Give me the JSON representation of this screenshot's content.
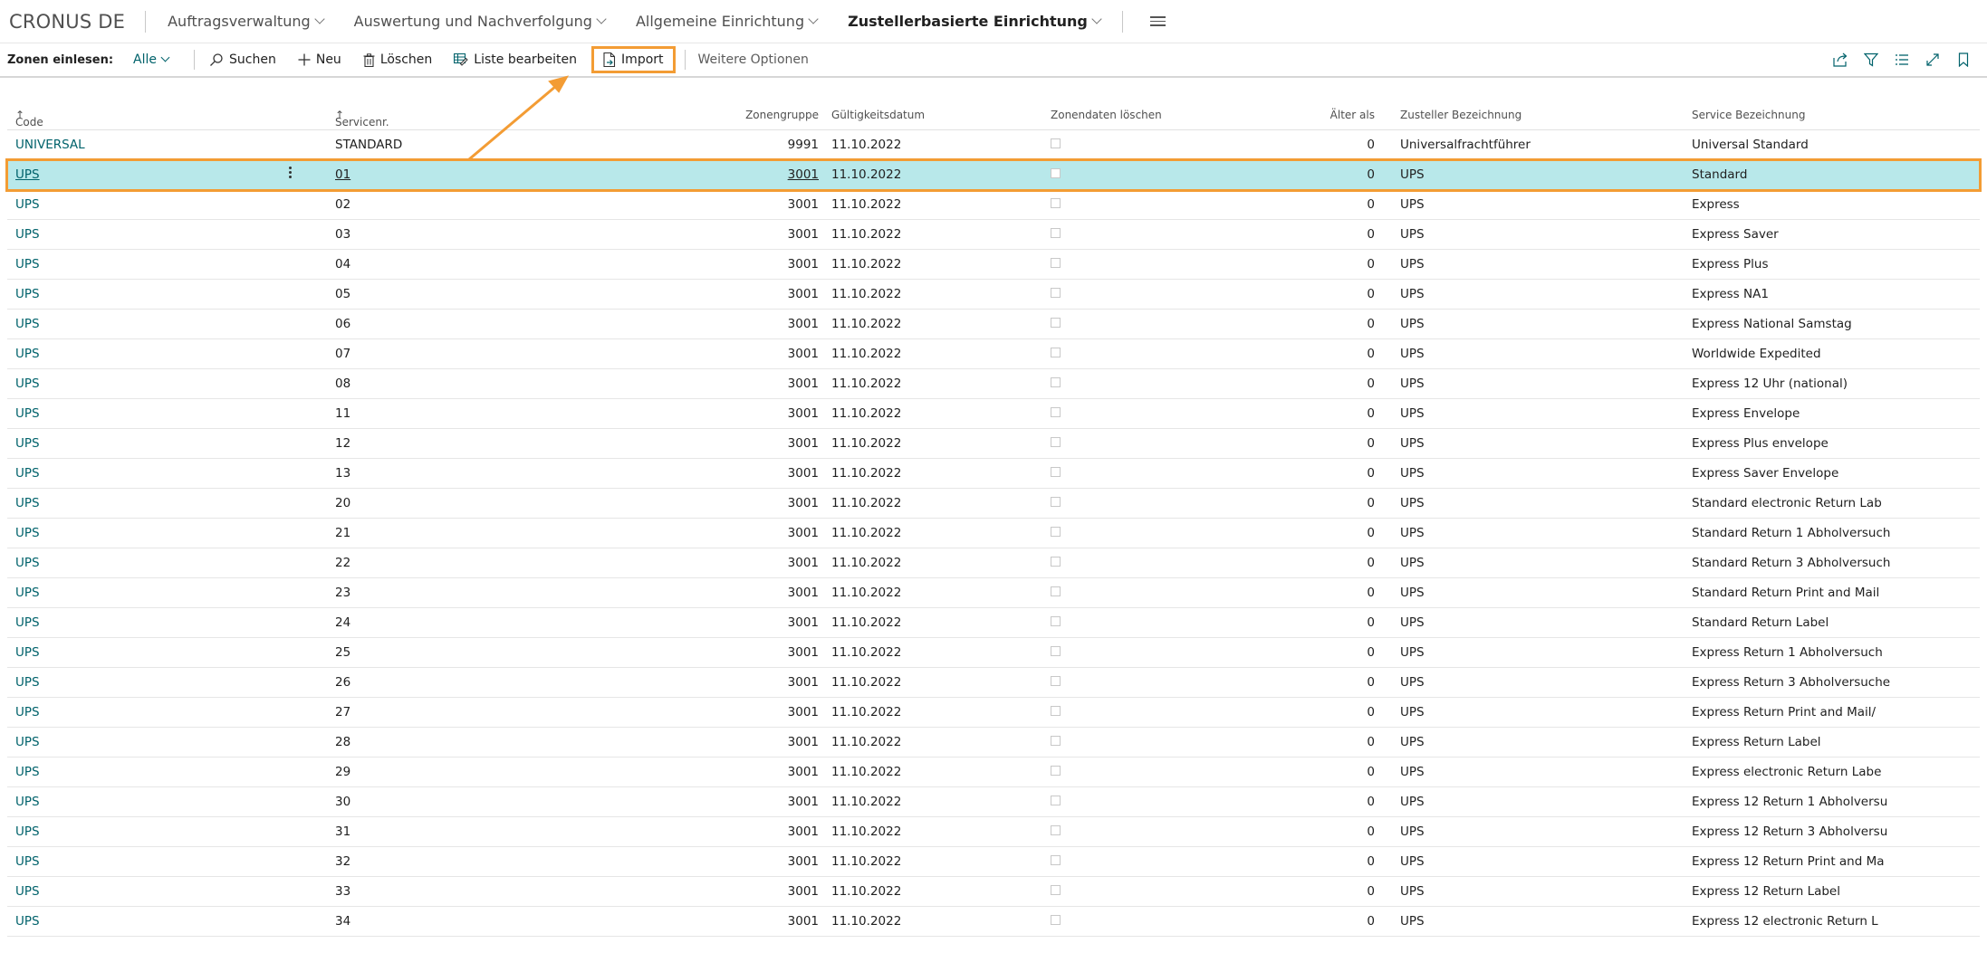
{
  "topnav": {
    "company": "CRONUS DE",
    "items": [
      {
        "label": "Auftragsverwaltung"
      },
      {
        "label": "Auswertung und Nachverfolgung"
      },
      {
        "label": "Allgemeine Einrichtung"
      },
      {
        "label": "Zustellerbasierte Einrichtung"
      }
    ]
  },
  "actionbar": {
    "label": "Zonen einlesen:",
    "filter": "Alle",
    "search": "Suchen",
    "new": "Neu",
    "delete": "Löschen",
    "edit_list": "Liste bearbeiten",
    "import": "Import",
    "more_options": "Weitere Optionen"
  },
  "columns": {
    "code": "Code",
    "service_no": "Servicenr.",
    "zone_group": "Zonengruppe",
    "valid_date": "Gültigkeitsdatum",
    "delete_zone": "Zonendaten löschen",
    "older_than": "Älter als",
    "carrier_name": "Zusteller Bezeichnung",
    "service_name": "Service Bezeichnung"
  },
  "rows": [
    {
      "code": "UNIVERSAL",
      "svc": "STANDARD",
      "zone": "9991",
      "date": "11.10.2022",
      "age": "0",
      "carrier": "Universalfrachtführer",
      "name": "Universal Standard"
    },
    {
      "code": "UPS",
      "svc": "01",
      "zone": "3001",
      "date": "11.10.2022",
      "age": "0",
      "carrier": "UPS",
      "name": "Standard"
    },
    {
      "code": "UPS",
      "svc": "02",
      "zone": "3001",
      "date": "11.10.2022",
      "age": "0",
      "carrier": "UPS",
      "name": "Express"
    },
    {
      "code": "UPS",
      "svc": "03",
      "zone": "3001",
      "date": "11.10.2022",
      "age": "0",
      "carrier": "UPS",
      "name": "Express Saver"
    },
    {
      "code": "UPS",
      "svc": "04",
      "zone": "3001",
      "date": "11.10.2022",
      "age": "0",
      "carrier": "UPS",
      "name": "Express Plus"
    },
    {
      "code": "UPS",
      "svc": "05",
      "zone": "3001",
      "date": "11.10.2022",
      "age": "0",
      "carrier": "UPS",
      "name": "Express NA1"
    },
    {
      "code": "UPS",
      "svc": "06",
      "zone": "3001",
      "date": "11.10.2022",
      "age": "0",
      "carrier": "UPS",
      "name": "Express National Samstag"
    },
    {
      "code": "UPS",
      "svc": "07",
      "zone": "3001",
      "date": "11.10.2022",
      "age": "0",
      "carrier": "UPS",
      "name": "Worldwide Expedited"
    },
    {
      "code": "UPS",
      "svc": "08",
      "zone": "3001",
      "date": "11.10.2022",
      "age": "0",
      "carrier": "UPS",
      "name": "Express 12 Uhr (national)"
    },
    {
      "code": "UPS",
      "svc": "11",
      "zone": "3001",
      "date": "11.10.2022",
      "age": "0",
      "carrier": "UPS",
      "name": "Express Envelope"
    },
    {
      "code": "UPS",
      "svc": "12",
      "zone": "3001",
      "date": "11.10.2022",
      "age": "0",
      "carrier": "UPS",
      "name": "Express Plus envelope"
    },
    {
      "code": "UPS",
      "svc": "13",
      "zone": "3001",
      "date": "11.10.2022",
      "age": "0",
      "carrier": "UPS",
      "name": "Express Saver Envelope"
    },
    {
      "code": "UPS",
      "svc": "20",
      "zone": "3001",
      "date": "11.10.2022",
      "age": "0",
      "carrier": "UPS",
      "name": "Standard electronic Return Lab"
    },
    {
      "code": "UPS",
      "svc": "21",
      "zone": "3001",
      "date": "11.10.2022",
      "age": "0",
      "carrier": "UPS",
      "name": "Standard Return 1 Abholversuch"
    },
    {
      "code": "UPS",
      "svc": "22",
      "zone": "3001",
      "date": "11.10.2022",
      "age": "0",
      "carrier": "UPS",
      "name": "Standard Return 3 Abholversuch"
    },
    {
      "code": "UPS",
      "svc": "23",
      "zone": "3001",
      "date": "11.10.2022",
      "age": "0",
      "carrier": "UPS",
      "name": "Standard Return Print and Mail"
    },
    {
      "code": "UPS",
      "svc": "24",
      "zone": "3001",
      "date": "11.10.2022",
      "age": "0",
      "carrier": "UPS",
      "name": "Standard Return Label"
    },
    {
      "code": "UPS",
      "svc": "25",
      "zone": "3001",
      "date": "11.10.2022",
      "age": "0",
      "carrier": "UPS",
      "name": "Express Return 1 Abholversuch"
    },
    {
      "code": "UPS",
      "svc": "26",
      "zone": "3001",
      "date": "11.10.2022",
      "age": "0",
      "carrier": "UPS",
      "name": "Express Return 3 Abholversuche"
    },
    {
      "code": "UPS",
      "svc": "27",
      "zone": "3001",
      "date": "11.10.2022",
      "age": "0",
      "carrier": "UPS",
      "name": "Express Return Print and Mail/"
    },
    {
      "code": "UPS",
      "svc": "28",
      "zone": "3001",
      "date": "11.10.2022",
      "age": "0",
      "carrier": "UPS",
      "name": "Express Return Label"
    },
    {
      "code": "UPS",
      "svc": "29",
      "zone": "3001",
      "date": "11.10.2022",
      "age": "0",
      "carrier": "UPS",
      "name": "Express electronic Return Labe"
    },
    {
      "code": "UPS",
      "svc": "30",
      "zone": "3001",
      "date": "11.10.2022",
      "age": "0",
      "carrier": "UPS",
      "name": "Express 12 Return 1 Abholversu"
    },
    {
      "code": "UPS",
      "svc": "31",
      "zone": "3001",
      "date": "11.10.2022",
      "age": "0",
      "carrier": "UPS",
      "name": "Express 12 Return 3 Abholversu"
    },
    {
      "code": "UPS",
      "svc": "32",
      "zone": "3001",
      "date": "11.10.2022",
      "age": "0",
      "carrier": "UPS",
      "name": "Express 12 Return Print and Ma"
    },
    {
      "code": "UPS",
      "svc": "33",
      "zone": "3001",
      "date": "11.10.2022",
      "age": "0",
      "carrier": "UPS",
      "name": "Express 12 Return Label"
    },
    {
      "code": "UPS",
      "svc": "34",
      "zone": "3001",
      "date": "11.10.2022",
      "age": "0",
      "carrier": "UPS",
      "name": "Express 12 electronic Return L"
    }
  ],
  "colors": {
    "accent": "#00626b",
    "highlight": "#f39c34",
    "selected_row": "#b8e8ea"
  }
}
